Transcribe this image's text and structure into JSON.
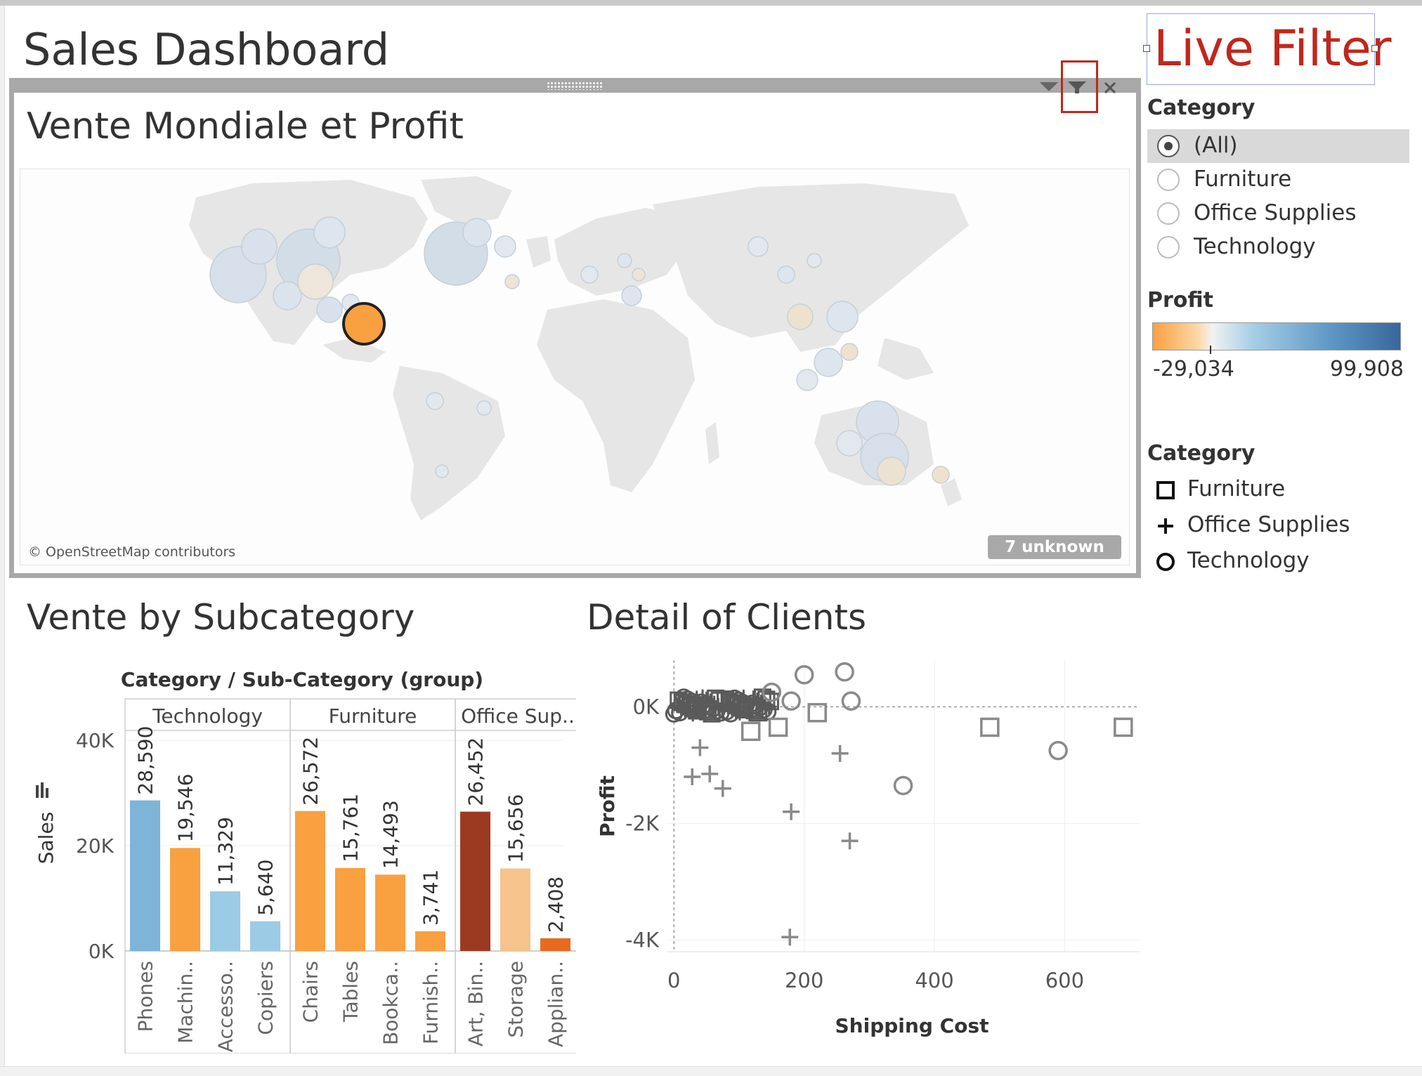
{
  "dashboard": {
    "title": "Sales Dashboard",
    "live_filter_title": "Live Filter"
  },
  "map": {
    "title": "Vente Mondiale et Profit",
    "attribution": "© OpenStreetMap contributors",
    "unknown_badge": "7 unknown",
    "toolbar_icons": [
      "dropdown-icon",
      "filter-icon",
      "close-icon"
    ]
  },
  "filter_panel": {
    "category_label": "Category",
    "options": [
      {
        "label": "(All)",
        "selected": true
      },
      {
        "label": "Furniture",
        "selected": false
      },
      {
        "label": "Office Supplies",
        "selected": false
      },
      {
        "label": "Technology",
        "selected": false
      }
    ],
    "profit_label": "Profit",
    "profit_min": "-29,034",
    "profit_max": "99,908",
    "shape_legend_label": "Category",
    "shape_legend": [
      {
        "label": "Furniture",
        "shape": "square"
      },
      {
        "label": "Office Supplies",
        "shape": "plus"
      },
      {
        "label": "Technology",
        "shape": "circle"
      }
    ]
  },
  "subcategory_section": {
    "title": "Vente by Subcategory"
  },
  "clients_section": {
    "title": "Detail of Clients"
  },
  "colors": {
    "accent_red": "#c0271c",
    "orange": "#f9a040",
    "blue": "#7db4d8",
    "light_blue": "#9ccbe5",
    "dark_red": "#9c3a21",
    "peach": "#f5c38b",
    "dark_orange": "#e86a20",
    "frame_gray": "#a8a8a8"
  },
  "chart_data": [
    {
      "type": "bar",
      "header": "Category / Sub-Category (group)",
      "ylabel": "Sales",
      "yticks": [
        "40K",
        "20K",
        "0K"
      ],
      "ylim": [
        0,
        40000
      ],
      "groups": [
        {
          "name": "Technology",
          "categories": [
            {
              "label": "Phones",
              "value": 28590,
              "value_label": "28,590",
              "color": "#7db4d8"
            },
            {
              "label": "Machin..",
              "value": 19546,
              "value_label": "19,546",
              "color": "#f9a040"
            },
            {
              "label": "Accesso..",
              "value": 11329,
              "value_label": "11,329",
              "color": "#9ccbe5"
            },
            {
              "label": "Copiers",
              "value": 5640,
              "value_label": "5,640",
              "color": "#9ccbe5"
            }
          ]
        },
        {
          "name": "Furniture",
          "categories": [
            {
              "label": "Chairs",
              "value": 26572,
              "value_label": "26,572",
              "color": "#f9a040"
            },
            {
              "label": "Tables",
              "value": 15761,
              "value_label": "15,761",
              "color": "#f9a040"
            },
            {
              "label": "Bookca..",
              "value": 14493,
              "value_label": "14,493",
              "color": "#f9a040"
            },
            {
              "label": "Furnish..",
              "value": 3741,
              "value_label": "3,741",
              "color": "#f9a040"
            }
          ]
        },
        {
          "name": "Office Sup..",
          "categories": [
            {
              "label": "Art, Bin..",
              "value": 26452,
              "value_label": "26,452",
              "color": "#9c3a21"
            },
            {
              "label": "Storage",
              "value": 15656,
              "value_label": "15,656",
              "color": "#f5c38b"
            },
            {
              "label": "Applian..",
              "value": 2408,
              "value_label": "2,408",
              "color": "#e86a20"
            }
          ]
        }
      ]
    },
    {
      "type": "scatter",
      "xlabel": "Shipping Cost",
      "ylabel": "Profit",
      "xticks": [
        0,
        200,
        400,
        600
      ],
      "xtick_labels": [
        "0",
        "200",
        "400",
        "600"
      ],
      "yticks": [
        0,
        -2000,
        -4000
      ],
      "ytick_labels": [
        "0K",
        "-2K",
        "-4K"
      ],
      "xlim": [
        -10,
        715
      ],
      "ylim": [
        -4200,
        800
      ],
      "points": [
        {
          "x": 200,
          "y": 550,
          "shape": "circle"
        },
        {
          "x": 262,
          "y": 600,
          "shape": "circle"
        },
        {
          "x": 272,
          "y": 100,
          "shape": "circle"
        },
        {
          "x": 590,
          "y": -750,
          "shape": "circle"
        },
        {
          "x": 352,
          "y": -1350,
          "shape": "circle"
        },
        {
          "x": 150,
          "y": 250,
          "shape": "circle"
        },
        {
          "x": 180,
          "y": 100,
          "shape": "circle"
        },
        {
          "x": 220,
          "y": -100,
          "shape": "square"
        },
        {
          "x": 485,
          "y": -350,
          "shape": "square"
        },
        {
          "x": 690,
          "y": -350,
          "shape": "square"
        },
        {
          "x": 160,
          "y": -350,
          "shape": "square"
        },
        {
          "x": 118,
          "y": -420,
          "shape": "square"
        },
        {
          "x": 40,
          "y": -700,
          "shape": "plus"
        },
        {
          "x": 28,
          "y": -1200,
          "shape": "plus"
        },
        {
          "x": 55,
          "y": -1150,
          "shape": "plus"
        },
        {
          "x": 75,
          "y": -1400,
          "shape": "plus"
        },
        {
          "x": 255,
          "y": -800,
          "shape": "plus"
        },
        {
          "x": 180,
          "y": -1800,
          "shape": "plus"
        },
        {
          "x": 270,
          "y": -2300,
          "shape": "plus"
        },
        {
          "x": 178,
          "y": -3950,
          "shape": "plus"
        }
      ]
    }
  ]
}
